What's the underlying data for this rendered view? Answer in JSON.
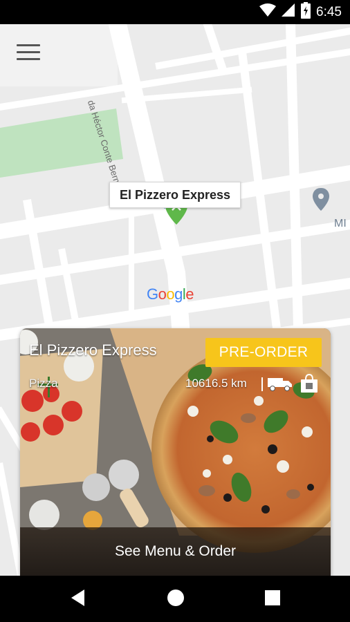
{
  "status_bar": {
    "time": "6:45",
    "icons": [
      "wifi-icon",
      "signal-icon",
      "battery-icon"
    ]
  },
  "map": {
    "street_label": "Calle Héctor Conte Bermúdez",
    "street_label_visible": "da Héctor Conte Bermúdez",
    "poi_label": "MI",
    "google_logo": "Google",
    "pin_label": "El Pizzero Express"
  },
  "card": {
    "title": "El Pizzero Express",
    "category": "Pizza",
    "preorder_label": "PRE-ORDER",
    "distance": "10616.5 km",
    "cta_label": "See Menu & Order",
    "colors": {
      "preorder": "#f7c51b"
    }
  },
  "nav": {
    "buttons": [
      "back-icon",
      "home-icon",
      "recents-icon"
    ]
  }
}
